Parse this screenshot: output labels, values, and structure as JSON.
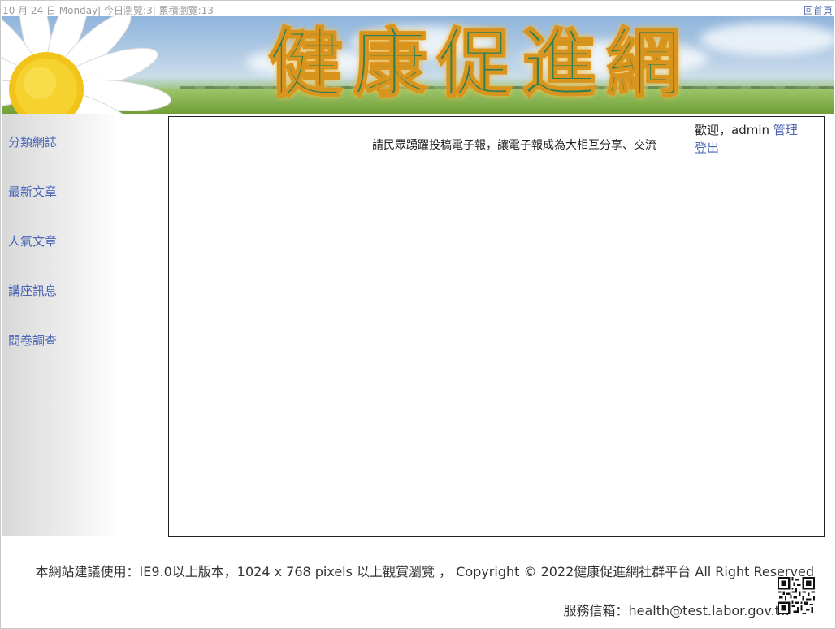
{
  "topbar": {
    "info": "10 月 24 日 Monday| 今日瀏覽:3| 累積瀏覽:13",
    "home_link": "回首頁"
  },
  "banner": {
    "title": "健康促進網"
  },
  "sidebar": {
    "items": [
      {
        "label": "分類網誌"
      },
      {
        "label": "最新文章"
      },
      {
        "label": "人氣文章"
      },
      {
        "label": "講座訊息"
      },
      {
        "label": "問卷調查"
      }
    ]
  },
  "content": {
    "marquee": "請民眾踴躍投稿電子報，讓電子報成為大相互分享、交流",
    "welcome_prefix": "歡迎，admin",
    "manage_link": "管理",
    "logout_link": "登出"
  },
  "footer": {
    "line1": "本網站建議使用：IE9.0以上版本，1024 x 768 pixels 以上觀賞瀏覽 ， Copyright © 2022健康促進網社群平台 All Right Reserved",
    "line2": "服務信箱：health@test.labor.gov.tw"
  },
  "colors": {
    "link": "#4a65b6",
    "banner_title": "#2e7f52",
    "banner_title_outline": "#d9941e"
  },
  "icons": {
    "daisy": "daisy-flower-icon",
    "qr": "qr-code-icon"
  }
}
